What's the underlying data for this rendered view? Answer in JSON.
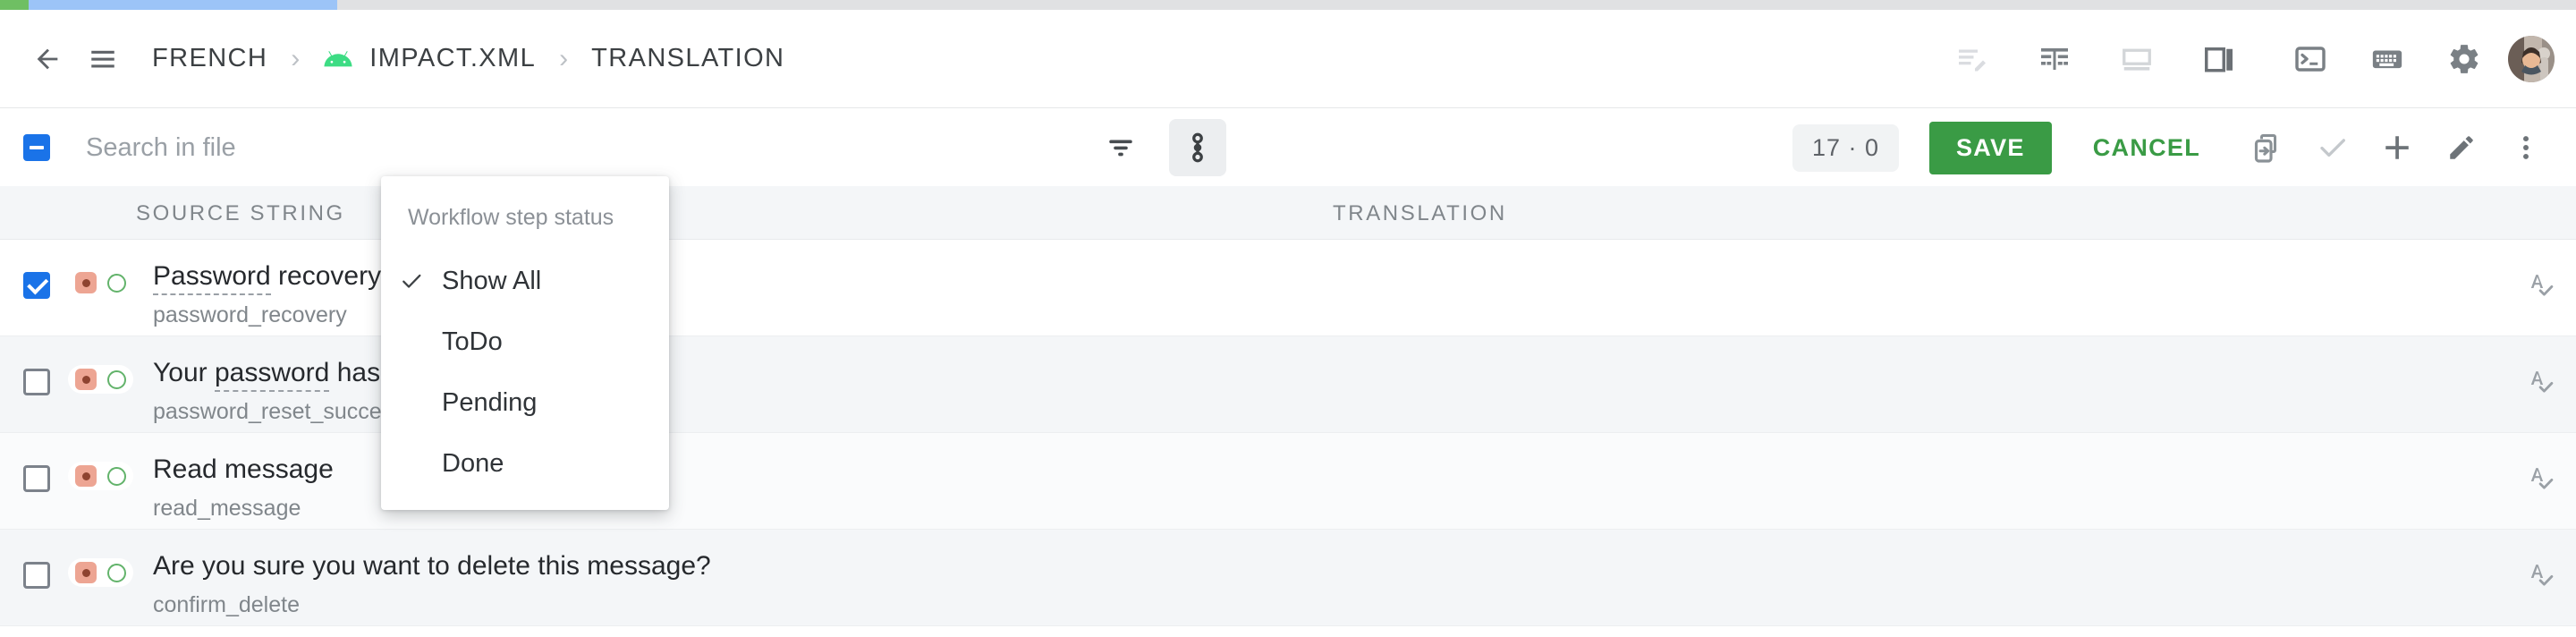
{
  "progress": {
    "green_pct": 1.1,
    "blue_pct": 13.1
  },
  "header": {
    "back_icon": "arrow-left-icon",
    "menu_icon": "hamburger-menu-icon",
    "breadcrumbs": [
      {
        "label": "FRENCH",
        "icon": null
      },
      {
        "label": "IMPACT.XML",
        "icon": "android-icon"
      },
      {
        "label": "TRANSLATION",
        "icon": null
      }
    ],
    "separator": "›",
    "actions": [
      {
        "name": "edit-text-icon",
        "title": "Edit"
      },
      {
        "name": "table-layout-icon",
        "title": "Layout"
      },
      {
        "name": "horizontal-split-icon",
        "title": "Horizontal split"
      },
      {
        "name": "vertical-split-icon",
        "title": "Vertical split"
      },
      {
        "name": "terminal-icon",
        "title": "Terminal"
      },
      {
        "name": "keyboard-icon",
        "title": "Keyboard"
      },
      {
        "name": "gear-icon",
        "title": "Settings"
      }
    ],
    "avatar": "user-avatar"
  },
  "toolbar": {
    "select_all_state": "indeterminate",
    "search": {
      "placeholder": "Search in file",
      "value": ""
    },
    "filter_icon": "filter-icon",
    "workflow_icon": "workflow-chain-icon",
    "count_badge": "17 · 0",
    "save_label": "SAVE",
    "cancel_label": "CANCEL",
    "right_actions": [
      {
        "name": "copy-to-device-icon",
        "title": "Copy"
      },
      {
        "name": "check-icon",
        "title": "Approve"
      },
      {
        "name": "plus-icon",
        "title": "Add"
      },
      {
        "name": "pencil-icon",
        "title": "Edit"
      },
      {
        "name": "more-vert-icon",
        "title": "More"
      }
    ]
  },
  "table": {
    "columns": {
      "source": "SOURCE STRING",
      "translation": "TRANSLATION"
    },
    "rows": [
      {
        "checked": true,
        "source": "Password recovery",
        "spell_word": "Password",
        "key": "password_recovery",
        "translation": "",
        "row_icon": "spellcheck-icon",
        "shade": "white"
      },
      {
        "checked": false,
        "source": "Your password has been reset",
        "spell_word": "password",
        "key": "password_reset_success",
        "translation": "",
        "row_icon": "spellcheck-icon",
        "shade": "tint"
      },
      {
        "checked": false,
        "source": "Read message",
        "spell_word": "",
        "key": "read_message",
        "translation": "",
        "row_icon": "spellcheck-icon",
        "shade": "tint2"
      },
      {
        "checked": false,
        "source": "Are you sure you want to delete this message?",
        "spell_word": "",
        "key": "confirm_delete",
        "translation": "",
        "row_icon": "spellcheck-icon",
        "shade": "tint"
      }
    ]
  },
  "menu": {
    "title": "Workflow step status",
    "items": [
      {
        "label": "Show All",
        "selected": true
      },
      {
        "label": "ToDo",
        "selected": false
      },
      {
        "label": "Pending",
        "selected": false
      },
      {
        "label": "Done",
        "selected": false
      }
    ]
  },
  "colors": {
    "brand_green": "#3a9b45",
    "accent_blue": "#1a73e8",
    "progress_green": "#6fbf63",
    "progress_blue": "#9cc4f7",
    "status_red": "#eda593",
    "status_green": "#63b36b"
  }
}
